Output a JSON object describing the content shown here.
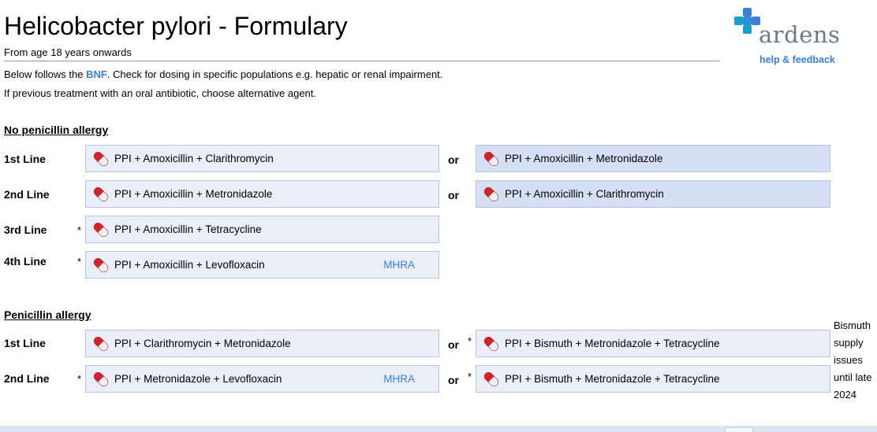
{
  "page": {
    "title": "Helicobacter pylori - Formulary",
    "subtitle": "From age 18 years onwards",
    "desc1_prefix": "Below follows the ",
    "desc1_link": "BNF",
    "desc1_suffix": ". Check for dosing in specific populations e.g. hepatic or renal impairment.",
    "desc2": "If previous treatment with an oral antibiotic, choose alternative agent."
  },
  "logo": {
    "word": "ardens",
    "help": "help & feedback",
    "colors": {
      "teal": "#1aa0c8",
      "blue": "#3a7fd5",
      "grey": "#6a7a88"
    }
  },
  "no_penicillin": {
    "heading": "No penicillin allergy",
    "rows": [
      {
        "label": "1st Line",
        "star": "",
        "left": "PPI + Amoxicillin + Clarithromycin",
        "or": "or",
        "right": "PPI + Amoxicillin + Metronidazole"
      },
      {
        "label": "2nd Line",
        "star": "",
        "left": "PPI + Amoxicillin + Metronidazole",
        "or": "or",
        "right": "PPI + Amoxicillin + Clarithromycin"
      },
      {
        "label": "3rd Line",
        "star": "*",
        "left": "PPI + Amoxicillin + Tetracycline"
      },
      {
        "label": "4th Line",
        "star": "*",
        "left": "PPI + Amoxicillin + Levofloxacin",
        "mhra": "MHRA"
      }
    ]
  },
  "penicillin": {
    "heading": "Penicillin allergy",
    "rows": [
      {
        "label": "1st Line",
        "star": "",
        "left": "PPI + Clarithromycin + Metronidazole",
        "or": "or",
        "or_star": "*",
        "right": "PPI + Bismuth + Metronidazole + Tetracycline"
      },
      {
        "label": "2nd Line",
        "star": "*",
        "left": "PPI + Metronidazole + Levofloxacin",
        "mhra": "MHRA",
        "or": "or",
        "or_star": "*",
        "right": "PPI + Bismuth + Metronidazole + Tetracycline"
      }
    ],
    "note": [
      "Bismuth",
      "supply",
      "issues",
      "until late",
      "2024"
    ]
  },
  "icons": {
    "drug": "pill-capsule-icon"
  },
  "colors": {
    "box_bg": "#e9eef9",
    "box_alt_bg": "#d6e0f5",
    "box_border": "#b7c5e0",
    "link": "#3a7fd5",
    "pill_red": "#d1232a"
  }
}
